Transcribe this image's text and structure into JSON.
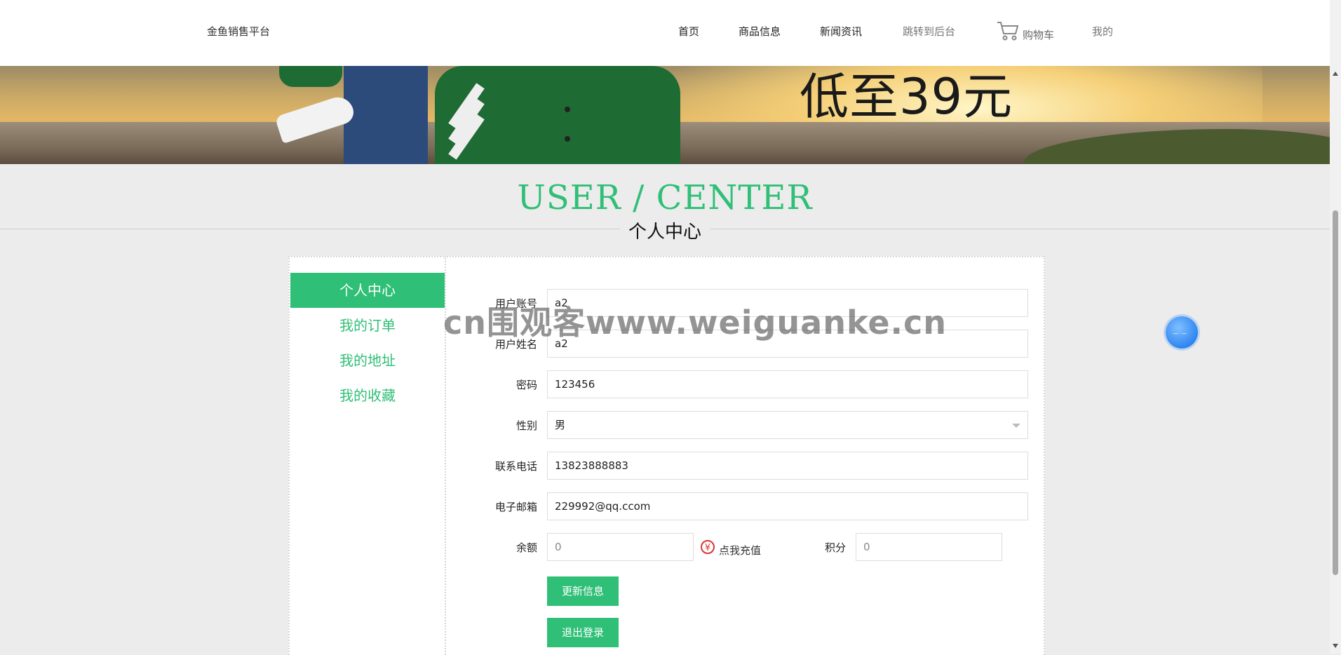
{
  "header": {
    "brand": "金鱼销售平台",
    "nav": {
      "home": "首页",
      "products": "商品信息",
      "news": "新闻资讯",
      "backend": "跳转到后台",
      "cart": "购物车",
      "mine": "我的"
    }
  },
  "banner": {
    "promo_text": "低至39元"
  },
  "section": {
    "title": "USER / CENTER",
    "subtitle": "个人中心"
  },
  "sidebar": {
    "items": [
      {
        "label": "个人中心",
        "active": true
      },
      {
        "label": "我的订单",
        "active": false
      },
      {
        "label": "我的地址",
        "active": false
      },
      {
        "label": "我的收藏",
        "active": false
      }
    ]
  },
  "form": {
    "account": {
      "label": "用户账号",
      "value": "a2"
    },
    "name": {
      "label": "用户姓名",
      "value": "a2"
    },
    "password": {
      "label": "密码",
      "value": "123456"
    },
    "gender": {
      "label": "性别",
      "value": "男"
    },
    "phone": {
      "label": "联系电话",
      "value": "13823888883"
    },
    "email": {
      "label": "电子邮箱",
      "value": "229992@qq.ccom"
    },
    "balance": {
      "label": "余额",
      "value": "0"
    },
    "recharge": "点我充值",
    "points": {
      "label": "积分",
      "value": "0"
    },
    "update_button": "更新信息",
    "logout_button": "退出登录"
  },
  "watermark": "cn围观客www.weiguanke.cn",
  "colors": {
    "accent": "#2fbf77",
    "background": "#ececec"
  }
}
